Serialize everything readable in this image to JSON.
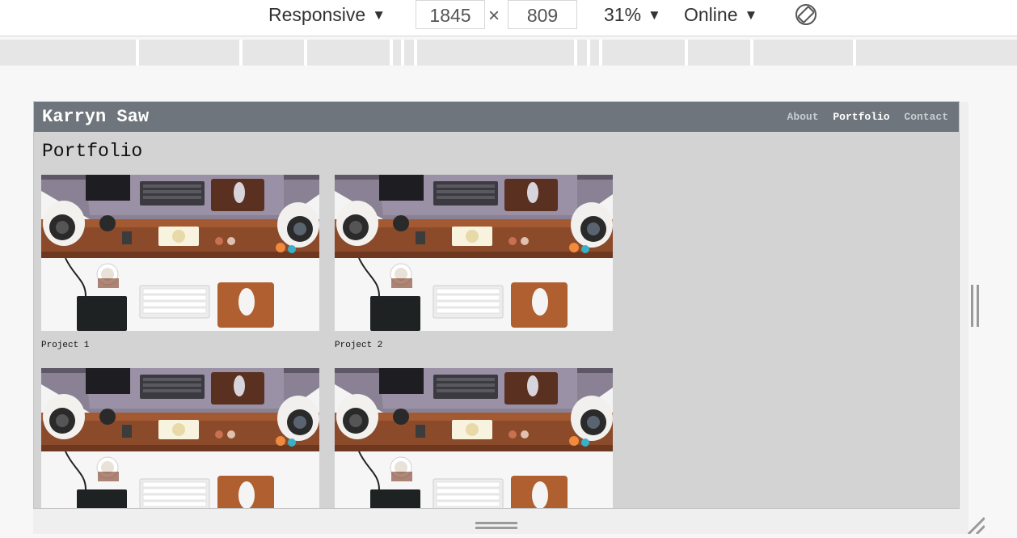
{
  "toolbar": {
    "device_label": "Responsive",
    "width_value": "1845",
    "times_symbol": "×",
    "height_value": "809",
    "zoom_label": "31%",
    "network_label": "Online",
    "caret": "▼"
  },
  "site": {
    "title": "Karryn Saw",
    "nav": [
      {
        "label": "About",
        "active": false
      },
      {
        "label": "Portfolio",
        "active": true
      },
      {
        "label": "Contact",
        "active": false
      }
    ],
    "page_title": "Portfolio",
    "projects": [
      {
        "label": "Project 1"
      },
      {
        "label": "Project 2"
      },
      {
        "label": ""
      },
      {
        "label": ""
      }
    ]
  },
  "icons": {
    "rotate": "rotate-icon",
    "resize_right": "resize-handle-icon",
    "resize_bottom": "resize-handle-icon",
    "resize_corner": "resize-corner-icon"
  },
  "colors": {
    "header_bg": "#6e757c",
    "page_bg": "#d3d3d3",
    "nav_active": "#ffffff",
    "nav_inactive": "#c8ccd0"
  }
}
